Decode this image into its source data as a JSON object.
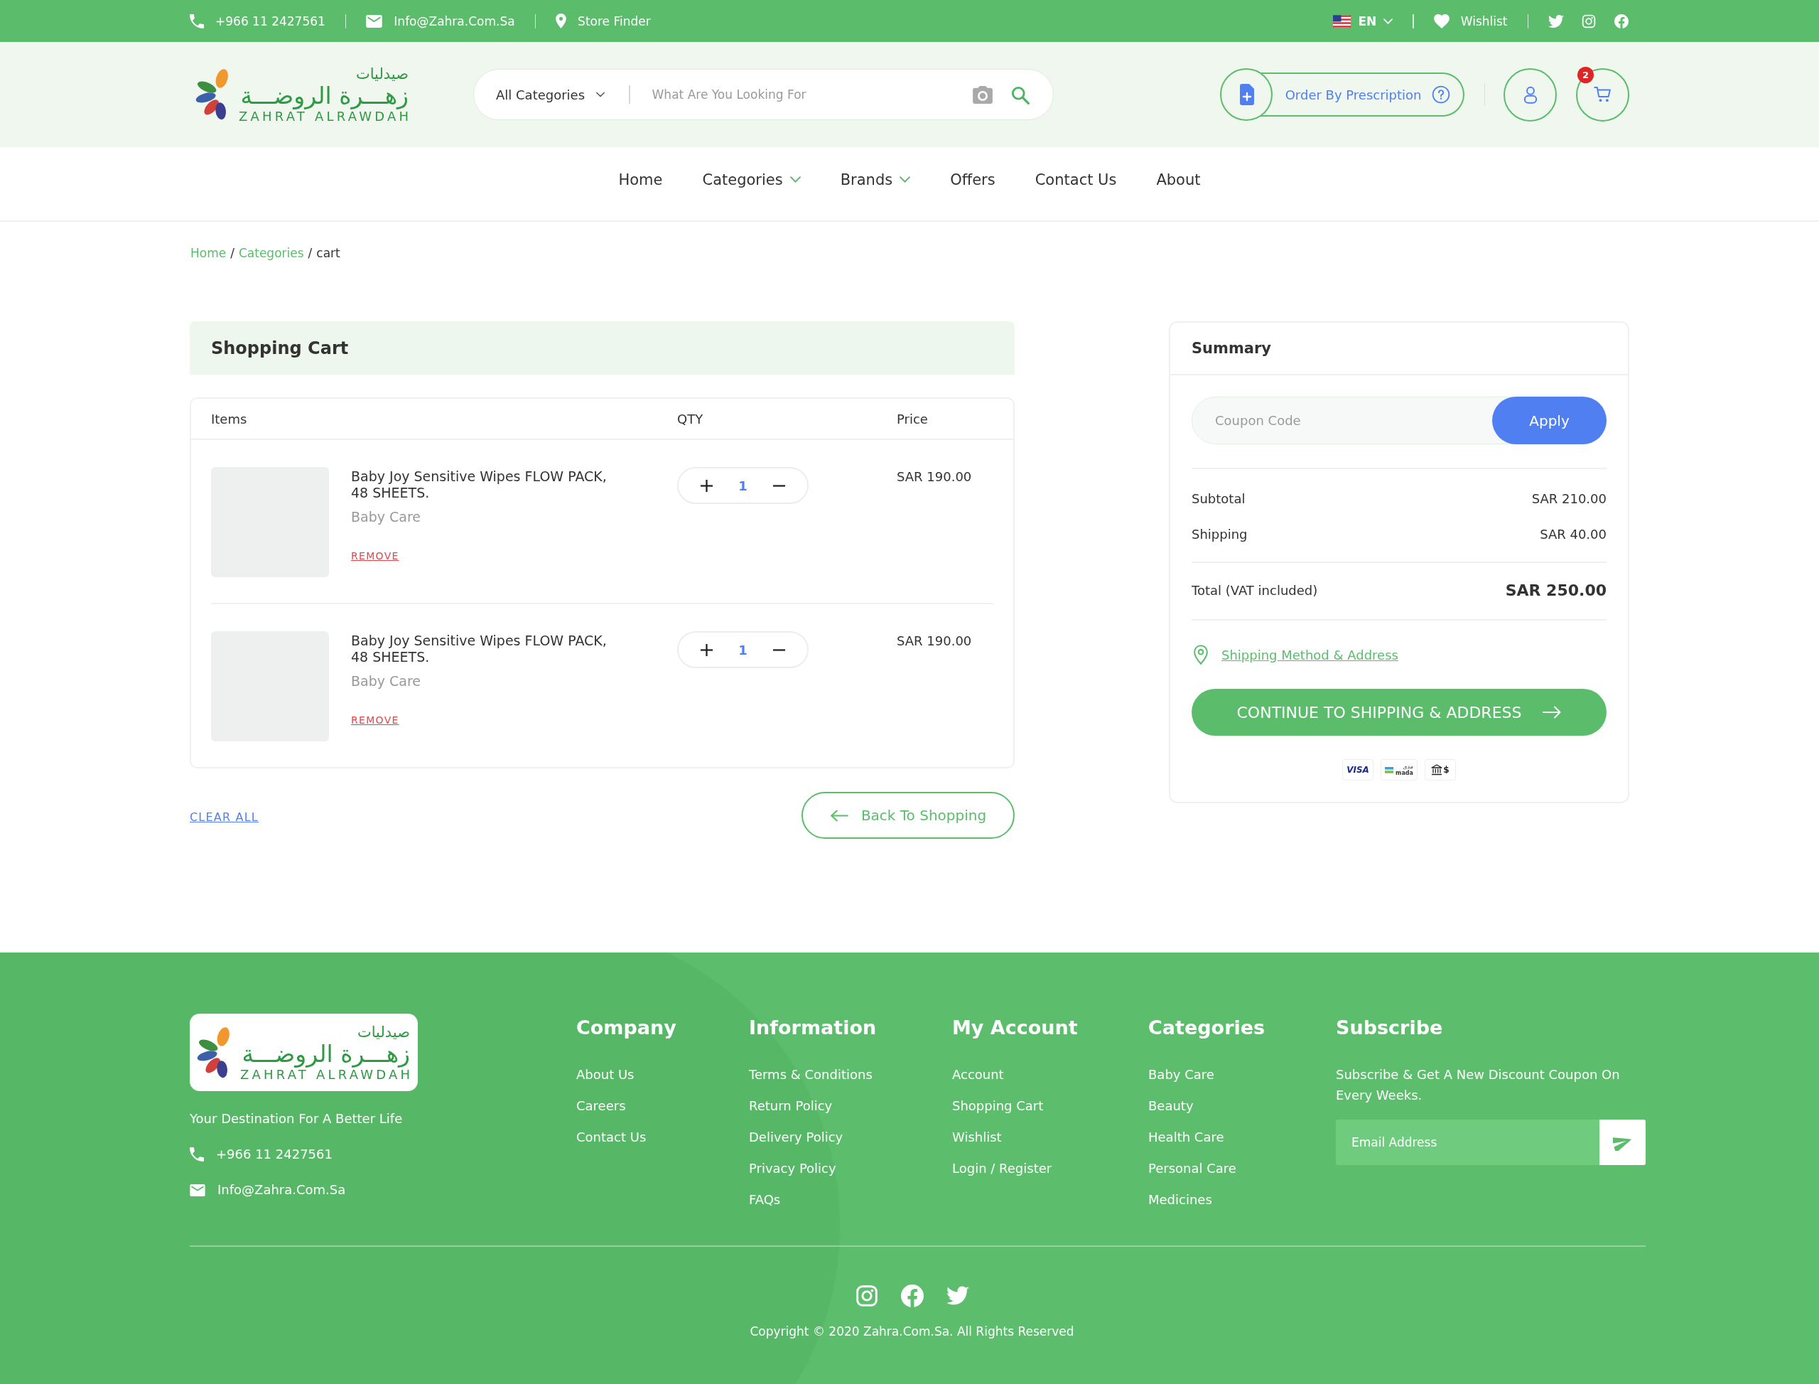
{
  "top_bar": {
    "phone": "+966 11 2427561",
    "email": "Info@Zahra.Com.Sa",
    "store_finder": "Store Finder",
    "language": "EN",
    "wishlist": "Wishlist"
  },
  "header": {
    "logo": {
      "arabic_top": "صيدليات",
      "arabic_name": "زهـــرة الروضـــة",
      "latin_name": "ZAHRAT ALRAWDAH"
    },
    "search": {
      "category": "All Categories",
      "placeholder": "What Are You Looking For"
    },
    "prescription_button": "Order By Prescription",
    "cart_count": "2"
  },
  "nav": [
    {
      "label": "Home",
      "has_dropdown": false
    },
    {
      "label": "Categories",
      "has_dropdown": true
    },
    {
      "label": "Brands",
      "has_dropdown": true
    },
    {
      "label": "Offers",
      "has_dropdown": false
    },
    {
      "label": "Contact Us",
      "has_dropdown": false
    },
    {
      "label": "About",
      "has_dropdown": false
    }
  ],
  "breadcrumb": {
    "separator": "/",
    "items": [
      {
        "label": "Home",
        "current": false
      },
      {
        "label": "Categories",
        "current": false
      },
      {
        "label": "cart",
        "current": true
      }
    ]
  },
  "cart": {
    "title": "Shopping Cart",
    "columns": [
      "Items",
      "QTY",
      "Price"
    ],
    "items": [
      {
        "name": "Baby Joy Sensitive Wipes FLOW PACK, 48 SHEETS.",
        "category": "Baby Care",
        "remove": "REMOVE",
        "quantity": "1",
        "price": "SAR 190.00"
      },
      {
        "name": "Baby Joy Sensitive Wipes FLOW PACK, 48 SHEETS.",
        "category": "Baby Care",
        "remove": "REMOVE",
        "quantity": "1",
        "price": "SAR 190.00"
      }
    ],
    "clear_all": "CLEAR ALL",
    "back_button": "Back To Shopping"
  },
  "summary": {
    "title": "Summary",
    "coupon": {
      "placeholder": "Coupon Code",
      "button": "Apply"
    },
    "rows": [
      {
        "label": "Subtotal",
        "value": "SAR 210.00"
      },
      {
        "label": "Shipping",
        "value": "SAR 40.00"
      }
    ],
    "total": {
      "label": "Total (VAT included)",
      "value": "SAR 250.00"
    },
    "shipping_link": "Shipping Method & Address",
    "continue_button": "CONTINUE TO SHIPPING & ADDRESS",
    "payment_methods": [
      {
        "kind": "visa",
        "label": "VISA"
      },
      {
        "kind": "mada",
        "label": "mada",
        "label_ar": "مدى"
      },
      {
        "kind": "bank",
        "label": "$"
      }
    ]
  },
  "footer": {
    "logo": {
      "arabic_top": "صيدليات",
      "arabic_name": "زهـــرة الروضـــة",
      "latin_name": "ZAHRAT ALRAWDAH"
    },
    "tagline": "Your Destination For A Better Life",
    "phone": "+966 11 2427561",
    "email": "Info@Zahra.Com.Sa",
    "columns": [
      {
        "title": "Company",
        "links": [
          "About Us",
          "Careers",
          "Contact Us"
        ]
      },
      {
        "title": "Information",
        "links": [
          "Terms & Conditions",
          "Return Policy",
          "Delivery Policy",
          "Privacy Policy",
          "FAQs"
        ]
      },
      {
        "title": "My Account",
        "links": [
          "Account",
          "Shopping Cart",
          "Wishlist",
          "Login / Register"
        ]
      },
      {
        "title": "Categories",
        "links": [
          "Baby Care",
          "Beauty",
          "Health Care",
          "Personal Care",
          "Medicines"
        ]
      }
    ],
    "subscribe": {
      "title": "Subscribe",
      "text": "Subscribe & Get A New Discount Coupon On Every Weeks.",
      "placeholder": "Email Address"
    },
    "copyright": "Copyright © 2020 Zahra.Com.Sa. All Rights Reserved"
  }
}
